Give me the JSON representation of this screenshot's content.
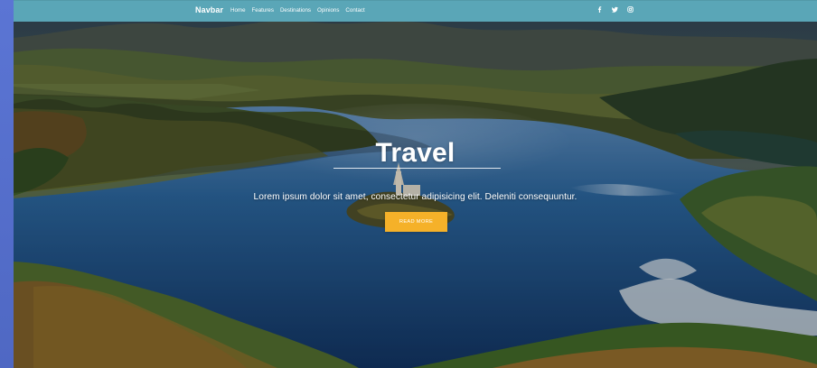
{
  "navbar": {
    "brand": "Navbar",
    "links": [
      "Home",
      "Features",
      "Destinations",
      "Opinions",
      "Contact"
    ],
    "social_icons": [
      "facebook-icon",
      "twitter-icon",
      "instagram-icon"
    ]
  },
  "hero": {
    "title": "Travel",
    "subtitle": "Lorem ipsum dolor sit amet, consectetur adipisicing elit. Deleniti consequuntur.",
    "button_label": "READ MORE"
  },
  "colors": {
    "navbar": "#5aa6b7",
    "button": "#f5b129",
    "left_strip": "#4f68c3",
    "lake": "#1d4c7a",
    "text": "#ffffff"
  }
}
